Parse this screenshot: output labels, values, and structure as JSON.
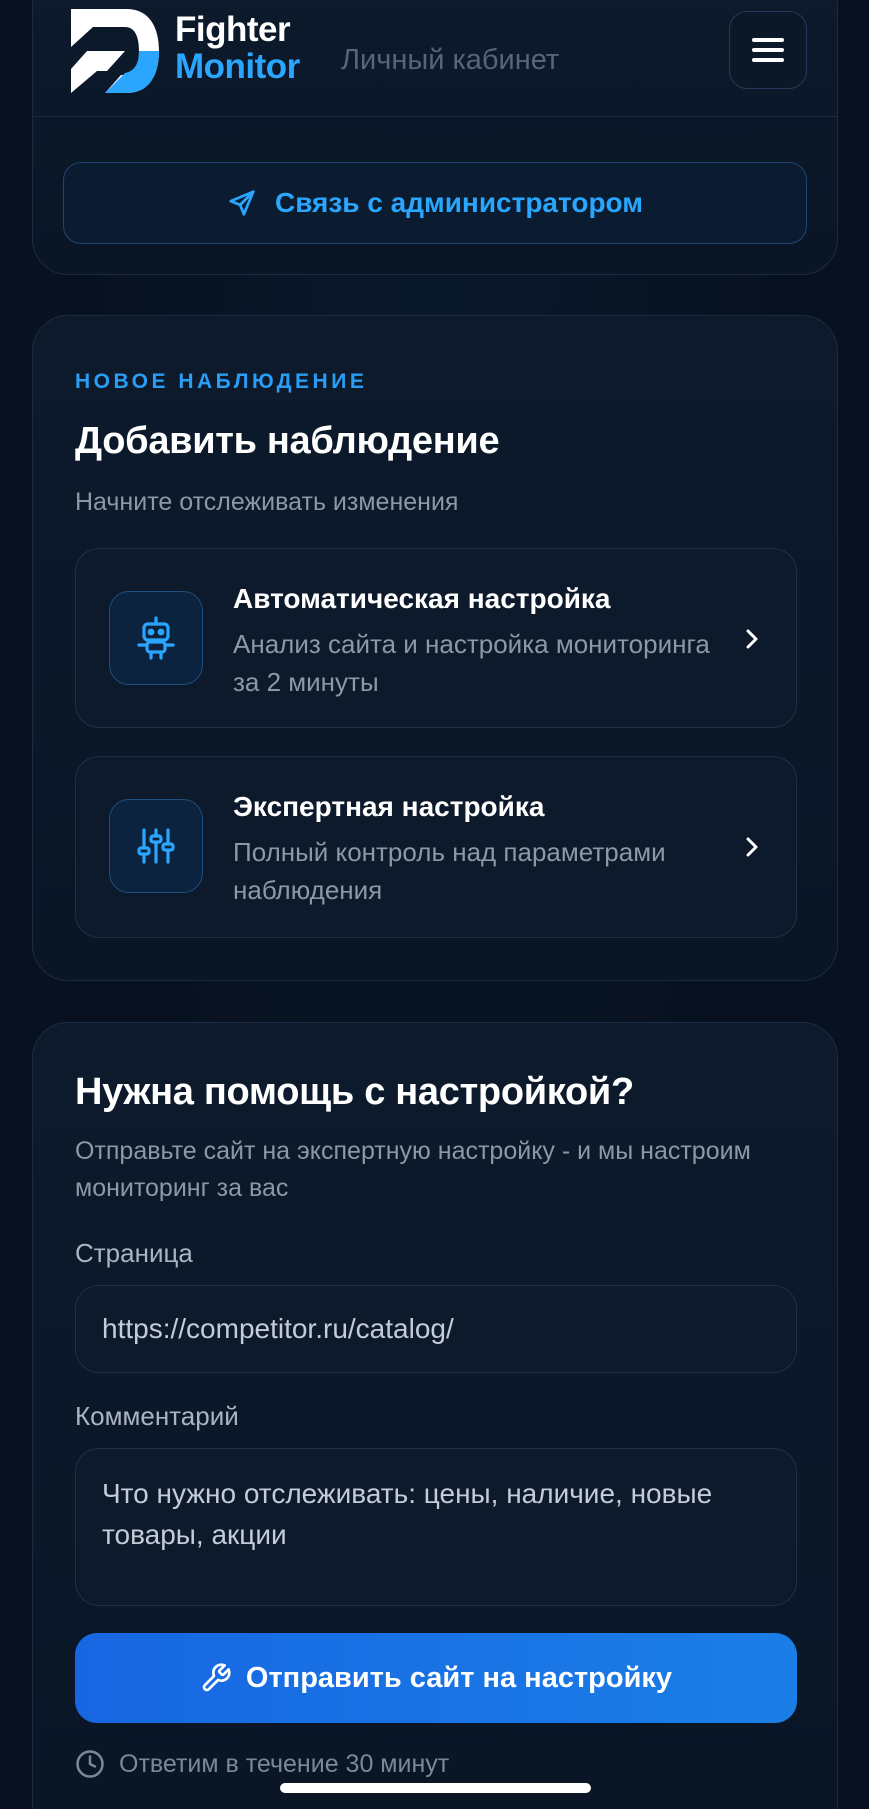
{
  "header": {
    "brand_line1": "Fighter",
    "brand_line2": "Monitor",
    "section": "Личный кабинет",
    "contact_label": "Связь с администратором"
  },
  "add_observation": {
    "overline": "НОВОЕ НАБЛЮДЕНИЕ",
    "title": "Добавить наблюдение",
    "subtitle": "Начните отслеживать изменения",
    "options": [
      {
        "icon": "robot-icon",
        "title": "Автоматическая настройка",
        "desc": "Анализ сайта и настройка мониторинга за 2 минуты"
      },
      {
        "icon": "sliders-icon",
        "title": "Экспертная настройка",
        "desc": "Полный контроль над параметрами наблюдения"
      }
    ]
  },
  "help": {
    "title": "Нужна помощь с настройкой?",
    "subtitle": "Отправьте сайт на экспертную настройку - и мы настроим мониторинг за вас",
    "page_label": "Страница",
    "page_placeholder": "https://competitor.ru/catalog/",
    "comment_label": "Комментарий",
    "comment_placeholder": "Что нужно отслеживать: цены, наличие, новые товары, акции",
    "submit_label": "Отправить сайт на настройку",
    "reply_note": "Ответим в течение 30 минут"
  },
  "colors": {
    "background": "#07111f",
    "accent": "#2aa6ff",
    "button": "#1767e2"
  }
}
